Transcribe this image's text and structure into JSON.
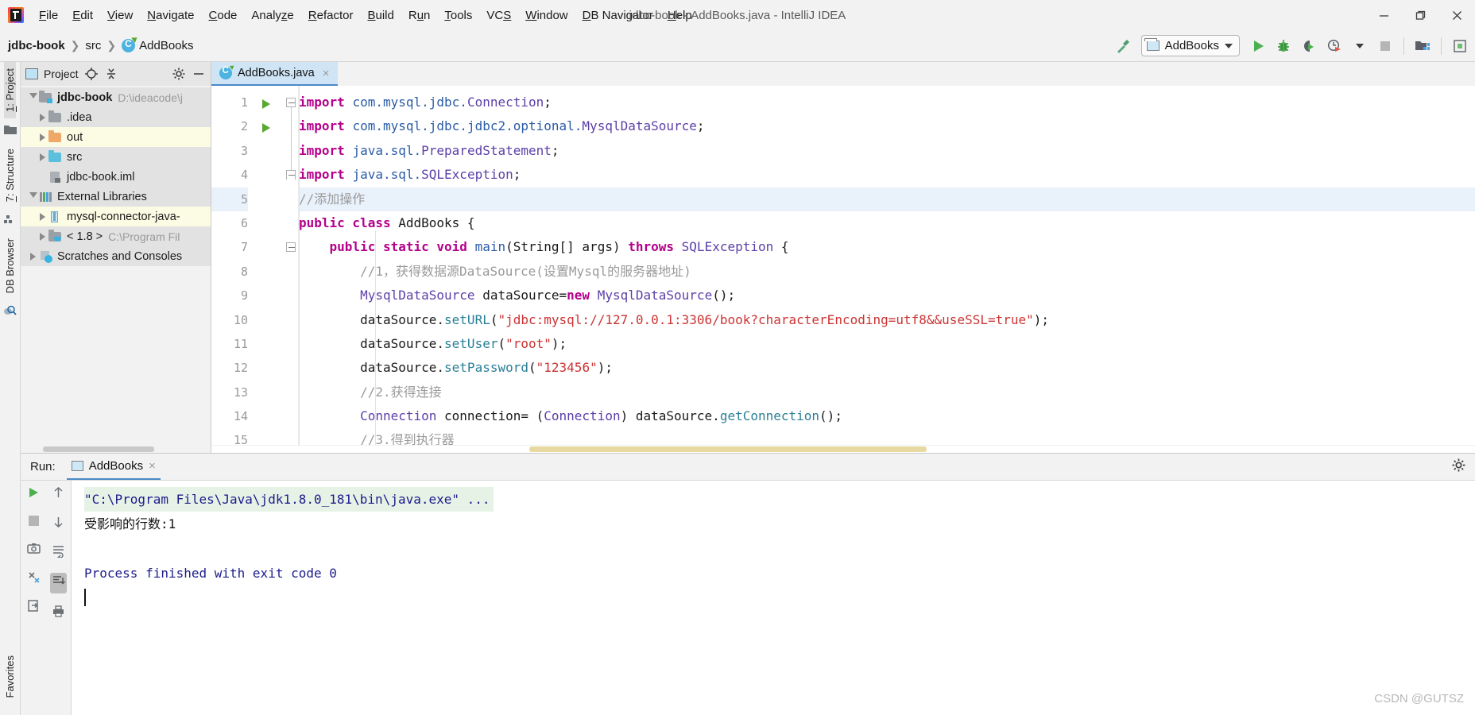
{
  "window": {
    "title": "jdbc-book - AddBooks.java - IntelliJ IDEA",
    "minimize_label": "minimize-window",
    "maximize_label": "restore-window",
    "close_label": "close-window"
  },
  "menu": {
    "items": [
      {
        "label": "File",
        "mnemonic": "F"
      },
      {
        "label": "Edit",
        "mnemonic": "E"
      },
      {
        "label": "View",
        "mnemonic": "V"
      },
      {
        "label": "Navigate",
        "mnemonic": "N"
      },
      {
        "label": "Code",
        "mnemonic": "C"
      },
      {
        "label": "Analyze",
        "mnemonic": "z"
      },
      {
        "label": "Refactor",
        "mnemonic": "R"
      },
      {
        "label": "Build",
        "mnemonic": "B"
      },
      {
        "label": "Run",
        "mnemonic": "u"
      },
      {
        "label": "Tools",
        "mnemonic": "T"
      },
      {
        "label": "VCS",
        "mnemonic": "S"
      },
      {
        "label": "Window",
        "mnemonic": "W"
      },
      {
        "label": "DB Navigator",
        "mnemonic": "D"
      },
      {
        "label": "Help",
        "mnemonic": "H"
      }
    ]
  },
  "navbar": {
    "breadcrumb": [
      "jdbc-book",
      "src",
      "AddBooks"
    ],
    "run_config": "AddBooks",
    "buttons": {
      "build": "Build Project",
      "run": "Run",
      "debug": "Debug",
      "run_coverage": "Run with Coverage",
      "profile": "Profile",
      "stop": "Stop",
      "project_structure": "Project Structure",
      "sdk": "SDK"
    }
  },
  "left_strip": {
    "tabs": [
      {
        "label": "1: Project",
        "mnemonic": "1",
        "active": true
      },
      {
        "label": "7: Structure",
        "mnemonic": "7",
        "active": false
      },
      {
        "label": "DB Browser",
        "active": false
      },
      {
        "label": "Favorites",
        "active": false
      }
    ]
  },
  "project_panel": {
    "title": "Project",
    "toolbar": [
      "locate-icon",
      "collapse-all-icon",
      "settings-icon",
      "hide-icon"
    ],
    "tree": [
      {
        "label": "jdbc-book",
        "path": "D:\\ideacode\\j",
        "icon": "module-folder",
        "expanded": true,
        "indent": 0,
        "bold": true,
        "highlight": "grey"
      },
      {
        "label": ".idea",
        "path": "",
        "icon": "folder-grey",
        "expanded": false,
        "indent": 1,
        "bold": false,
        "highlight": "grey"
      },
      {
        "label": "out",
        "path": "",
        "icon": "folder-orange",
        "expanded": false,
        "indent": 1,
        "bold": false,
        "highlight": "yellow"
      },
      {
        "label": "src",
        "path": "",
        "icon": "folder-blue",
        "expanded": false,
        "indent": 1,
        "bold": false,
        "highlight": "grey"
      },
      {
        "label": "jdbc-book.iml",
        "path": "",
        "icon": "iml-file",
        "expanded": null,
        "indent": 1,
        "bold": false,
        "highlight": "grey"
      },
      {
        "label": "External Libraries",
        "path": "",
        "icon": "libraries",
        "expanded": true,
        "indent": 0,
        "bold": false,
        "highlight": "grey"
      },
      {
        "label": "mysql-connector-java-",
        "path": "",
        "icon": "jar-file",
        "expanded": false,
        "indent": 1,
        "bold": false,
        "highlight": "yellow"
      },
      {
        "label": "< 1.8 >",
        "path": "C:\\Program Fil",
        "icon": "jdk-folder",
        "expanded": false,
        "indent": 1,
        "bold": false,
        "highlight": "grey"
      },
      {
        "label": "Scratches and Consoles",
        "path": "",
        "icon": "scratches",
        "expanded": false,
        "indent": 0,
        "bold": false,
        "highlight": "grey"
      }
    ]
  },
  "editor": {
    "tab": {
      "filename": "AddBooks.java",
      "close": "×"
    },
    "current_line": 5,
    "lines": [
      {
        "n": 1,
        "run_marker": false,
        "fold": "start"
      },
      {
        "n": 2,
        "run_marker": false,
        "fold": null
      },
      {
        "n": 3,
        "run_marker": false,
        "fold": null
      },
      {
        "n": 4,
        "run_marker": false,
        "fold": "end"
      },
      {
        "n": 5,
        "run_marker": false,
        "fold": null
      },
      {
        "n": 6,
        "run_marker": true,
        "fold": null
      },
      {
        "n": 7,
        "run_marker": true,
        "fold": "start"
      },
      {
        "n": 8,
        "run_marker": false,
        "fold": null
      },
      {
        "n": 9,
        "run_marker": false,
        "fold": null
      },
      {
        "n": 10,
        "run_marker": false,
        "fold": null
      },
      {
        "n": 11,
        "run_marker": false,
        "fold": null
      },
      {
        "n": 12,
        "run_marker": false,
        "fold": null
      },
      {
        "n": 13,
        "run_marker": false,
        "fold": null
      },
      {
        "n": 14,
        "run_marker": false,
        "fold": null
      },
      {
        "n": 15,
        "run_marker": false,
        "fold": null
      }
    ],
    "code": [
      "import com.mysql.jdbc.Connection;",
      "import com.mysql.jdbc.jdbc2.optional.MysqlDataSource;",
      "import java.sql.PreparedStatement;",
      "import java.sql.SQLException;",
      "//添加操作",
      "public class AddBooks {",
      "    public static void main(String[] args) throws SQLException {",
      "        //1，获得数据源DataSource(设置Mysql的服务器地址)",
      "        MysqlDataSource dataSource=new MysqlDataSource();",
      "        dataSource.setURL(\"jdbc:mysql://127.0.0.1:3306/book?characterEncoding=utf8&&useSSL=true\");",
      "        dataSource.setUser(\"root\");",
      "        dataSource.setPassword(\"123456\");",
      "        //2.获得连接",
      "        Connection connection= (Connection) dataSource.getConnection();",
      "        //3.得到执行器"
    ]
  },
  "run_panel": {
    "label": "Run:",
    "tab": "AddBooks",
    "tab_close": "×",
    "settings": "settings-gear",
    "toolbar_left": [
      "rerun-icon",
      "stop-icon",
      "dump-icon",
      "thread-icon",
      "export-icon"
    ],
    "toolbar_right": [
      "up-icon",
      "down-icon",
      "soft-wrap-icon",
      "scroll-to-end-icon",
      "print-icon"
    ],
    "console": [
      {
        "text": "\"C:\\Program Files\\Java\\jdk1.8.0_181\\bin\\java.exe\" ...",
        "style": "command"
      },
      {
        "text": "受影响的行数:1",
        "style": "output"
      },
      {
        "text": "",
        "style": "output"
      },
      {
        "text": "Process finished with exit code 0",
        "style": "output"
      }
    ]
  },
  "watermark": "CSDN @GUTSZ",
  "colors": {
    "accent_blue": "#4a89c8",
    "tab_active": "#cfe5f5",
    "keyword": "#b4008a",
    "string": "#cc3333",
    "comment": "#9a9a9a",
    "class_name": "#5c3fa8",
    "run_green": "#5aa832",
    "console_text": "#1c1c8c",
    "command_bg": "#e6f2e6"
  }
}
